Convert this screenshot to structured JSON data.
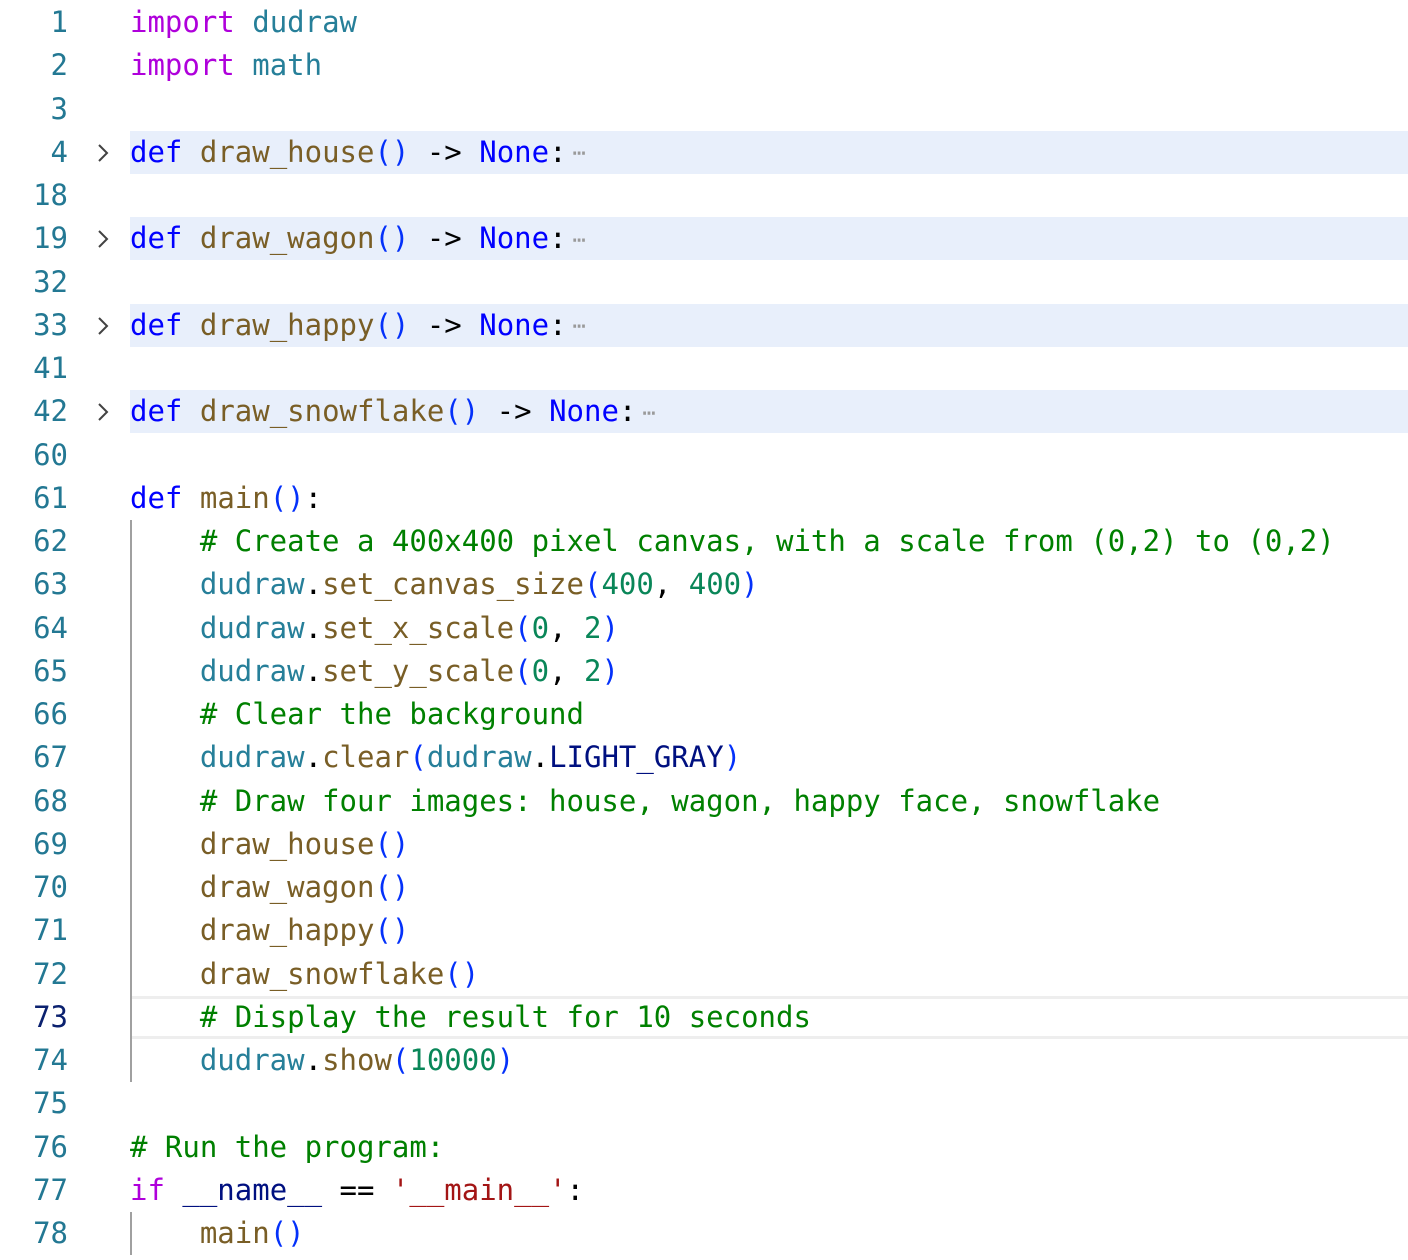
{
  "editor": {
    "lines": [
      {
        "n": "1",
        "tokens": [
          [
            "kw-ctrl",
            "import"
          ],
          [
            "op",
            " "
          ],
          [
            "mod",
            "dudraw"
          ]
        ]
      },
      {
        "n": "2",
        "tokens": [
          [
            "kw-ctrl",
            "import"
          ],
          [
            "op",
            " "
          ],
          [
            "mod",
            "math"
          ]
        ]
      },
      {
        "n": "3",
        "tokens": []
      },
      {
        "n": "4",
        "folded": true,
        "tokens": [
          [
            "kw",
            "def"
          ],
          [
            "op",
            " "
          ],
          [
            "fn",
            "draw_house"
          ],
          [
            "br",
            "()"
          ],
          [
            "op",
            " -> "
          ],
          [
            "kw",
            "None"
          ],
          [
            "op",
            ":"
          ]
        ]
      },
      {
        "n": "18",
        "tokens": []
      },
      {
        "n": "19",
        "folded": true,
        "tokens": [
          [
            "kw",
            "def"
          ],
          [
            "op",
            " "
          ],
          [
            "fn",
            "draw_wagon"
          ],
          [
            "br",
            "()"
          ],
          [
            "op",
            " -> "
          ],
          [
            "kw",
            "None"
          ],
          [
            "op",
            ":"
          ]
        ]
      },
      {
        "n": "32",
        "tokens": []
      },
      {
        "n": "33",
        "folded": true,
        "tokens": [
          [
            "kw",
            "def"
          ],
          [
            "op",
            " "
          ],
          [
            "fn",
            "draw_happy"
          ],
          [
            "br",
            "()"
          ],
          [
            "op",
            " -> "
          ],
          [
            "kw",
            "None"
          ],
          [
            "op",
            ":"
          ]
        ]
      },
      {
        "n": "41",
        "tokens": []
      },
      {
        "n": "42",
        "folded": true,
        "tokens": [
          [
            "kw",
            "def"
          ],
          [
            "op",
            " "
          ],
          [
            "fn",
            "draw_snowflake"
          ],
          [
            "br",
            "()"
          ],
          [
            "op",
            " -> "
          ],
          [
            "kw",
            "None"
          ],
          [
            "op",
            ":"
          ]
        ]
      },
      {
        "n": "60",
        "tokens": []
      },
      {
        "n": "61",
        "tokens": [
          [
            "kw",
            "def"
          ],
          [
            "op",
            " "
          ],
          [
            "fn",
            "main"
          ],
          [
            "br",
            "()"
          ],
          [
            "op",
            ":"
          ]
        ]
      },
      {
        "n": "62",
        "tokens": [
          [
            "op",
            "    "
          ],
          [
            "cmt",
            "# Create a 400x400 pixel canvas, with a scale from (0,2) to (0,2)"
          ]
        ]
      },
      {
        "n": "63",
        "tokens": [
          [
            "op",
            "    "
          ],
          [
            "ns",
            "dudraw"
          ],
          [
            "op",
            "."
          ],
          [
            "fn",
            "set_canvas_size"
          ],
          [
            "br",
            "("
          ],
          [
            "num",
            "400"
          ],
          [
            "op",
            ", "
          ],
          [
            "num",
            "400"
          ],
          [
            "br",
            ")"
          ]
        ]
      },
      {
        "n": "64",
        "tokens": [
          [
            "op",
            "    "
          ],
          [
            "ns",
            "dudraw"
          ],
          [
            "op",
            "."
          ],
          [
            "fn",
            "set_x_scale"
          ],
          [
            "br",
            "("
          ],
          [
            "num",
            "0"
          ],
          [
            "op",
            ", "
          ],
          [
            "num",
            "2"
          ],
          [
            "br",
            ")"
          ]
        ]
      },
      {
        "n": "65",
        "tokens": [
          [
            "op",
            "    "
          ],
          [
            "ns",
            "dudraw"
          ],
          [
            "op",
            "."
          ],
          [
            "fn",
            "set_y_scale"
          ],
          [
            "br",
            "("
          ],
          [
            "num",
            "0"
          ],
          [
            "op",
            ", "
          ],
          [
            "num",
            "2"
          ],
          [
            "br",
            ")"
          ]
        ]
      },
      {
        "n": "66",
        "tokens": [
          [
            "op",
            "    "
          ],
          [
            "cmt",
            "# Clear the background"
          ]
        ]
      },
      {
        "n": "67",
        "tokens": [
          [
            "op",
            "    "
          ],
          [
            "ns",
            "dudraw"
          ],
          [
            "op",
            "."
          ],
          [
            "fn",
            "clear"
          ],
          [
            "br",
            "("
          ],
          [
            "ns",
            "dudraw"
          ],
          [
            "op",
            "."
          ],
          [
            "var",
            "LIGHT_GRAY"
          ],
          [
            "br",
            ")"
          ]
        ]
      },
      {
        "n": "68",
        "tokens": [
          [
            "op",
            "    "
          ],
          [
            "cmt",
            "# Draw four images: house, wagon, happy face, snowflake"
          ]
        ]
      },
      {
        "n": "69",
        "tokens": [
          [
            "op",
            "    "
          ],
          [
            "fn",
            "draw_house"
          ],
          [
            "br",
            "()"
          ]
        ]
      },
      {
        "n": "70",
        "tokens": [
          [
            "op",
            "    "
          ],
          [
            "fn",
            "draw_wagon"
          ],
          [
            "br",
            "()"
          ]
        ]
      },
      {
        "n": "71",
        "tokens": [
          [
            "op",
            "    "
          ],
          [
            "fn",
            "draw_happy"
          ],
          [
            "br",
            "()"
          ]
        ]
      },
      {
        "n": "72",
        "tokens": [
          [
            "op",
            "    "
          ],
          [
            "fn",
            "draw_snowflake"
          ],
          [
            "br",
            "()"
          ]
        ]
      },
      {
        "n": "73",
        "current": true,
        "tokens": [
          [
            "op",
            "    "
          ],
          [
            "cmt",
            "# Display the result for 10 seconds"
          ]
        ]
      },
      {
        "n": "74",
        "tokens": [
          [
            "op",
            "    "
          ],
          [
            "ns",
            "dudraw"
          ],
          [
            "op",
            "."
          ],
          [
            "fn",
            "show"
          ],
          [
            "br",
            "("
          ],
          [
            "num",
            "10000"
          ],
          [
            "br",
            ")"
          ]
        ]
      },
      {
        "n": "75",
        "tokens": []
      },
      {
        "n": "76",
        "tokens": [
          [
            "cmt",
            "# Run the program:"
          ]
        ]
      },
      {
        "n": "77",
        "tokens": [
          [
            "kw-ctrl",
            "if"
          ],
          [
            "op",
            " "
          ],
          [
            "var",
            "__name__"
          ],
          [
            "op",
            " == "
          ],
          [
            "str",
            "'__main__'"
          ],
          [
            "op",
            ":"
          ]
        ]
      },
      {
        "n": "78",
        "tokens": [
          [
            "op",
            "    "
          ],
          [
            "fn",
            "main"
          ],
          [
            "br",
            "()"
          ]
        ]
      }
    ],
    "fold_ellipsis": "⋯",
    "fold_icon": "chevron-right-icon"
  }
}
